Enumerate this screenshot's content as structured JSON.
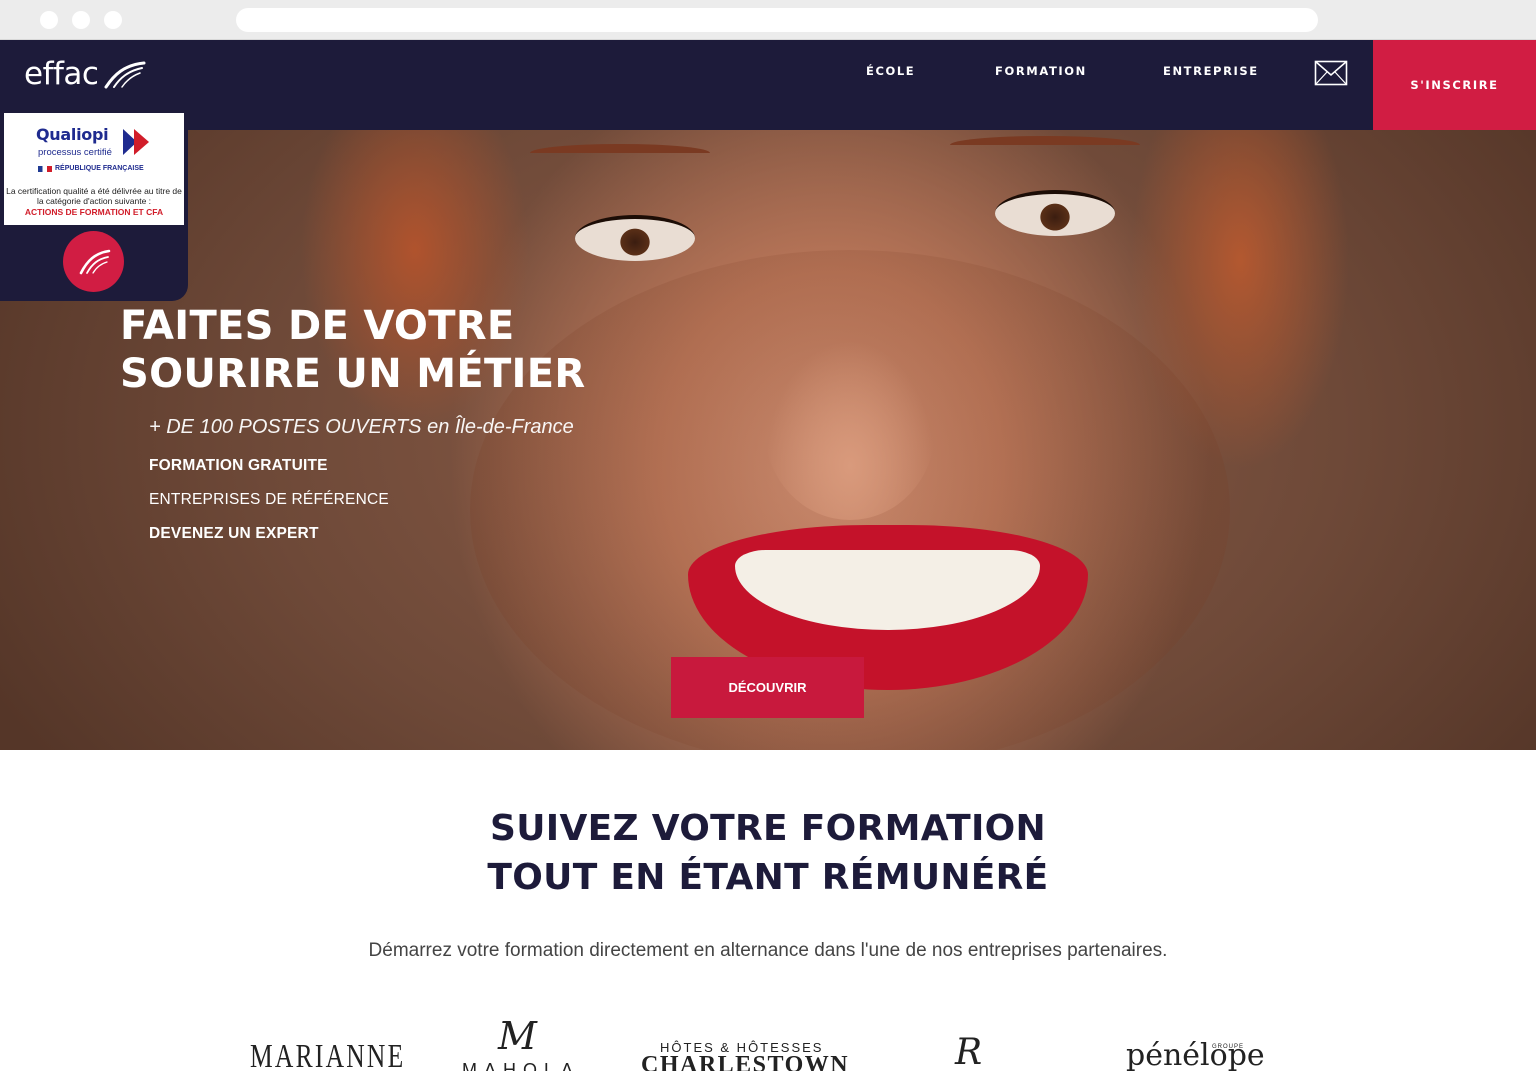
{
  "brand": {
    "logo_text": "effac",
    "accent_color": "#d11d43",
    "navy_color": "#1d1b3a"
  },
  "nav": {
    "items": [
      {
        "label": "ÉCOLE"
      },
      {
        "label": "FORMATION"
      },
      {
        "label": "ENTREPRISE"
      }
    ],
    "mail_icon": "envelope-icon",
    "cta_label": "S'INSCRIRE"
  },
  "qualiopi": {
    "name": "Qualiopi",
    "tagline": "processus certifié",
    "republic": "RÉPUBLIQUE FRANÇAISE",
    "text": "La certification qualité a été délivrée au titre de la catégorie d'action suivante :",
    "category": "ACTIONS DE FORMATION ET CFA",
    "circle_icon": "effac-mark-icon"
  },
  "hero": {
    "title_line1": "FAITES DE VOTRE",
    "title_line2": "SOURIRE UN MÉTIER",
    "subtitle": "+ DE 100 POSTES OUVERTS en Île-de-France",
    "items": [
      {
        "label": "FORMATION GRATUITE"
      },
      {
        "label": "ENTREPRISES DE RÉFÉRENCE"
      },
      {
        "label": "DEVENEZ UN EXPERT"
      }
    ],
    "button_label": "DÉCOUVRIR"
  },
  "section": {
    "title_line1": "SUIVEZ VOTRE FORMATION",
    "title_line2": "TOUT EN ÉTANT RÉMUNÉRÉ",
    "subtitle": "Démarrez votre formation directement en alternance dans l'une de nos entreprises partenaires."
  },
  "partners": {
    "marianne": "MARIANNE",
    "mahola_mark": "M",
    "mahola": "MAHOLA",
    "charlestown_top": "HÔTES  &  HÔTESSES",
    "charlestown": "CHARLESTOWN",
    "r_logo": "R",
    "penelope": "pénélope",
    "penelope_groupe": "GROUPE"
  }
}
